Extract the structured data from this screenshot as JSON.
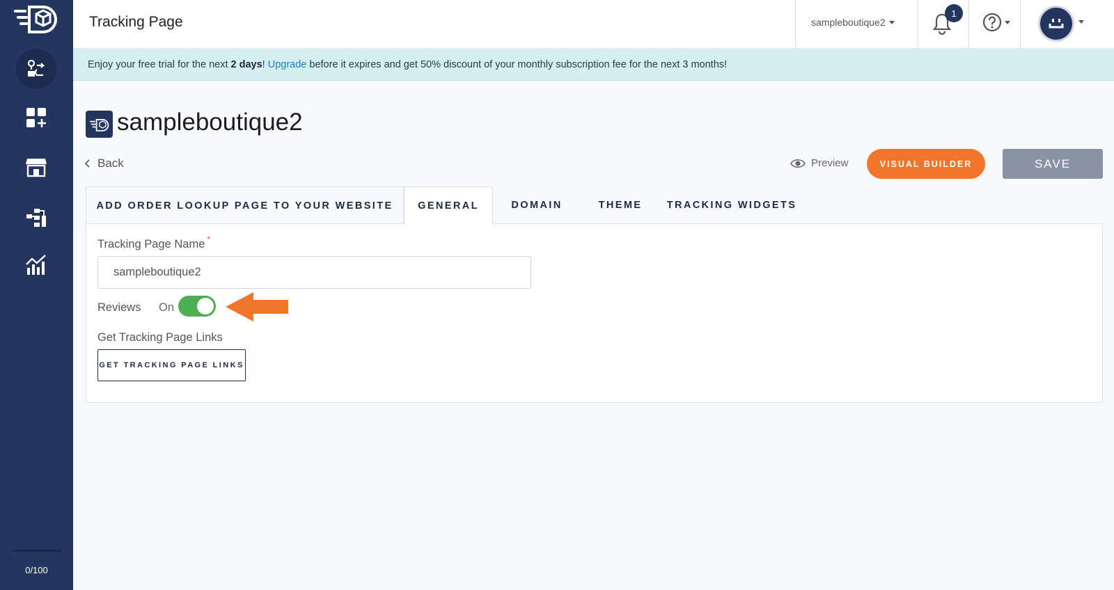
{
  "sidebar": {
    "logo_icon": "box-delivery-logo-icon",
    "items": [
      {
        "icon": "shipments-icon",
        "active": true
      },
      {
        "icon": "apps-add-icon",
        "active": false
      },
      {
        "icon": "store-icon",
        "active": false
      },
      {
        "icon": "workflow-icon",
        "active": false
      },
      {
        "icon": "analytics-icon",
        "active": false
      }
    ],
    "counter": "0/100"
  },
  "header": {
    "title": "Tracking Page",
    "store": "sampleboutique2",
    "notification_count": "1",
    "help_icon": "question-circle-icon",
    "avatar_icon": "user-avatar-icon"
  },
  "banner": {
    "prefix": "Enjoy your free trial for the next ",
    "days": "2 days",
    "excl": "! ",
    "link": "Upgrade",
    "suffix": " before it expires and get 50% discount of your monthly subscription fee for the next 3 months!"
  },
  "page": {
    "heading": "sampleboutique2",
    "back": "Back",
    "preview": "Preview",
    "visual_builder": "VISUAL BUILDER",
    "save": "SAVE"
  },
  "tabs": [
    {
      "label": "ADD ORDER LOOKUP PAGE TO YOUR WEBSITE",
      "active": false
    },
    {
      "label": "GENERAL",
      "active": true
    },
    {
      "label": "DOMAIN",
      "active": false
    },
    {
      "label": "THEME",
      "active": false
    },
    {
      "label": "TRACKING WIDGETS",
      "active": false
    }
  ],
  "form": {
    "name_label": "Tracking Page Name",
    "required_mark": "*",
    "name_value": "sampleboutique2",
    "reviews_label": "Reviews",
    "reviews_state": "On",
    "reviews_on": true,
    "links_label": "Get Tracking Page Links",
    "links_button": "GET TRACKING PAGE LINKS"
  },
  "colors": {
    "sidebar": "#24355f",
    "accent_orange": "#f27629",
    "toggle_on": "#4caf50",
    "banner_bg": "#d5eef0"
  }
}
